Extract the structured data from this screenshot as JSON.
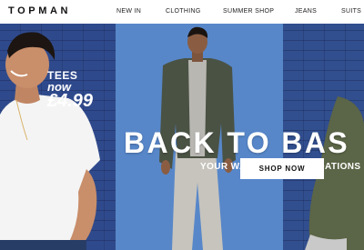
{
  "brand": {
    "logo": "TOPMAN"
  },
  "nav": {
    "items": [
      {
        "label": "NEW IN"
      },
      {
        "label": "CLOTHING"
      },
      {
        "label": "SUMMER SHOP"
      },
      {
        "label": "JEANS"
      },
      {
        "label": "SUITS"
      }
    ]
  },
  "promo": {
    "line1": "TEES",
    "line2": "now",
    "price": "£4.99"
  },
  "hero": {
    "headline": "BACK TO BAS",
    "subheadline": "YOUR WARDROBE FOUNDATIONS",
    "cta_label": "SHOP NOW"
  },
  "colors": {
    "panel_left": "#2f4a8c",
    "panel_middle": "#5787c9",
    "panel_right": "#314e8e",
    "text_on_hero": "#ffffff",
    "header_bg": "#ffffff"
  }
}
